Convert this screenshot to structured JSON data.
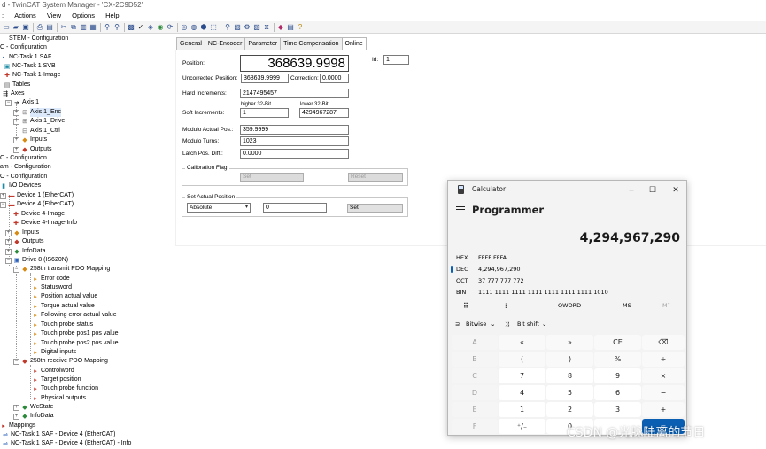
{
  "window": {
    "title": "d - TwinCAT System Manager - 'CX-2C9D52'"
  },
  "menu": [
    "Actions",
    "View",
    "Options",
    "Help"
  ],
  "menu_prefix": ":",
  "toolbar": [
    "new-icon",
    "open-icon",
    "save-icon",
    "print-icon",
    "preview-icon",
    "cut-icon",
    "copy-icon",
    "paste-icon",
    "paste-link-icon",
    "find-icon",
    "find-next-icon",
    "insert-device-icon",
    "check-icon",
    "activate-icon",
    "restart-icon",
    "reload-icon",
    "scan-icon",
    "toggle-free-run-icon",
    "config-mode-icon",
    "zoom-icon",
    "search-icon",
    "show-online-icon",
    "tools-icon",
    "chart-icon",
    "link-icon",
    "notes-icon",
    "help-icon"
  ],
  "tree": [
    {
      "label": "STEM - Configuration",
      "icon": "system-icon"
    },
    {
      "label": "C - Configuration",
      "icon": "nc-icon"
    },
    {
      "label": "NC-Task 1 SAF",
      "icon": "task-icon"
    },
    {
      "label": "NC-Task 1 SVB",
      "icon": "task-icon"
    },
    {
      "label": "NC-Task 1-Image",
      "icon": "image-icon"
    },
    {
      "label": "Tables",
      "icon": "table-icon"
    },
    {
      "label": "Axes",
      "icon": "axes-icon"
    },
    {
      "label": "Axis 1",
      "icon": "axis-icon"
    },
    {
      "label": "Axis 1_Enc",
      "icon": "encoder-icon"
    },
    {
      "label": "Axis 1_Drive",
      "icon": "drive-icon"
    },
    {
      "label": "Axis 1_Ctrl",
      "icon": "ctrl-icon"
    },
    {
      "label": "Inputs",
      "icon": "inputs-icon"
    },
    {
      "label": "Outputs",
      "icon": "outputs-icon"
    },
    {
      "label": "C - Configuration",
      "icon": "plc-icon"
    },
    {
      "label": "am - Configuration",
      "icon": "cam-icon"
    },
    {
      "label": "O - Configuration",
      "icon": "io-icon"
    },
    {
      "label": "I/O Devices",
      "icon": "io-devices-icon"
    },
    {
      "label": "Device 1 (EtherCAT)",
      "icon": "ethercat-icon"
    },
    {
      "label": "Device 4 (EtherCAT)",
      "icon": "ethercat-icon"
    },
    {
      "label": "Device 4-Image",
      "icon": "image-icon"
    },
    {
      "label": "Device 4-Image-Info",
      "icon": "image-icon"
    },
    {
      "label": "Inputs",
      "icon": "inputs-icon"
    },
    {
      "label": "Outputs",
      "icon": "outputs-icon"
    },
    {
      "label": "InfoData",
      "icon": "infodata-icon"
    },
    {
      "label": "Drive 8 (IS620N)",
      "icon": "drive-box-icon"
    },
    {
      "label": "258th transmit PDO Mapping",
      "icon": "pdo-in-icon"
    },
    {
      "label": "Error code",
      "icon": "var-in-icon"
    },
    {
      "label": "Statusword",
      "icon": "var-in-icon"
    },
    {
      "label": "Position actual value",
      "icon": "var-in-icon"
    },
    {
      "label": "Torque actual value",
      "icon": "var-in-icon"
    },
    {
      "label": "Following error actual value",
      "icon": "var-in-icon"
    },
    {
      "label": "Touch probe status",
      "icon": "var-in-icon"
    },
    {
      "label": "Touch probe pos1 pos value",
      "icon": "var-in-icon"
    },
    {
      "label": "Touch probe pos2 pos value",
      "icon": "var-in-icon"
    },
    {
      "label": "Digital inputs",
      "icon": "var-in-icon"
    },
    {
      "label": "258th receive PDO Mapping",
      "icon": "pdo-out-icon"
    },
    {
      "label": "Controlword",
      "icon": "var-out-icon"
    },
    {
      "label": "Target position",
      "icon": "var-out-icon"
    },
    {
      "label": "Touch probe function",
      "icon": "var-out-icon"
    },
    {
      "label": "Physical outputs",
      "icon": "var-out-icon"
    },
    {
      "label": "WcState",
      "icon": "wcstate-icon"
    },
    {
      "label": "InfoData",
      "icon": "infodata-icon"
    },
    {
      "label": "Mappings",
      "icon": "mappings-icon"
    },
    {
      "label": "NC-Task 1 SAF - Device 4 (EtherCAT)",
      "icon": "mapping-icon"
    },
    {
      "label": "NC-Task 1 SAF - Device 4 (EtherCAT) - Info",
      "icon": "mapping-icon"
    }
  ],
  "tabs": [
    "General",
    "NC-Encoder",
    "Parameter",
    "Time Compensation",
    "Online"
  ],
  "online": {
    "position_label": "Position:",
    "position_value": "368639.9998",
    "id_label": "Id:",
    "id_value": "1",
    "uncorrected_label": "Uncorrected Position:",
    "uncorrected_value": "368639.9999",
    "correction_label": "Correction:",
    "correction_value": "0.0000",
    "hard_increments_label": "Hard Increments:",
    "hard_increments_value": "2147495457",
    "higher_label": "higher 32-Bit",
    "lower_label": "lower 32-Bit",
    "soft_increments_label": "Soft Increments:",
    "soft_higher_value": "1",
    "soft_lower_value": "4294967287",
    "modulo_pos_label": "Modulo Actual Pos.:",
    "modulo_pos_value": "359.9999",
    "modulo_turns_label": "Modulo Turns:",
    "modulo_turns_value": "1023",
    "latch_label": "Latch Pos. Diff.:",
    "latch_value": "0.0000",
    "calibration_title": "Calibration Flag",
    "cal_set_label": "Set",
    "cal_reset_label": "Reset",
    "set_actual_title": "Set Actual Position",
    "set_mode_value": "Absolute",
    "set_value": "0",
    "set_button_label": "Set"
  },
  "calculator": {
    "title": "Calculator",
    "mode": "Programmer",
    "display": "4,294,967,290",
    "radix": [
      {
        "label": "HEX",
        "value": "FFFF FFFA"
      },
      {
        "label": "DEC",
        "value": "4,294,967,290"
      },
      {
        "label": "OCT",
        "value": "37 777 777 772"
      },
      {
        "label": "BIN",
        "value": "1111 1111 1111 1111 1111 1111 1111 1010"
      }
    ],
    "word_size": "QWORD",
    "memory_store": "MS",
    "memory_menu": "M˅",
    "bitwise_label": "Bitwise",
    "bitshift_label": "Bit shift",
    "keys": [
      [
        "A",
        "«",
        "»",
        "CE",
        "⌫"
      ],
      [
        "B",
        "(",
        ")",
        "%",
        "÷"
      ],
      [
        "C",
        "7",
        "8",
        "9",
        "×"
      ],
      [
        "D",
        "4",
        "5",
        "6",
        "−"
      ],
      [
        "E",
        "1",
        "2",
        "3",
        "+"
      ],
      [
        "F",
        "⁺/₋",
        "0",
        "",
        "="
      ]
    ]
  },
  "watermark": "CSDN @光脉陆离的节日"
}
